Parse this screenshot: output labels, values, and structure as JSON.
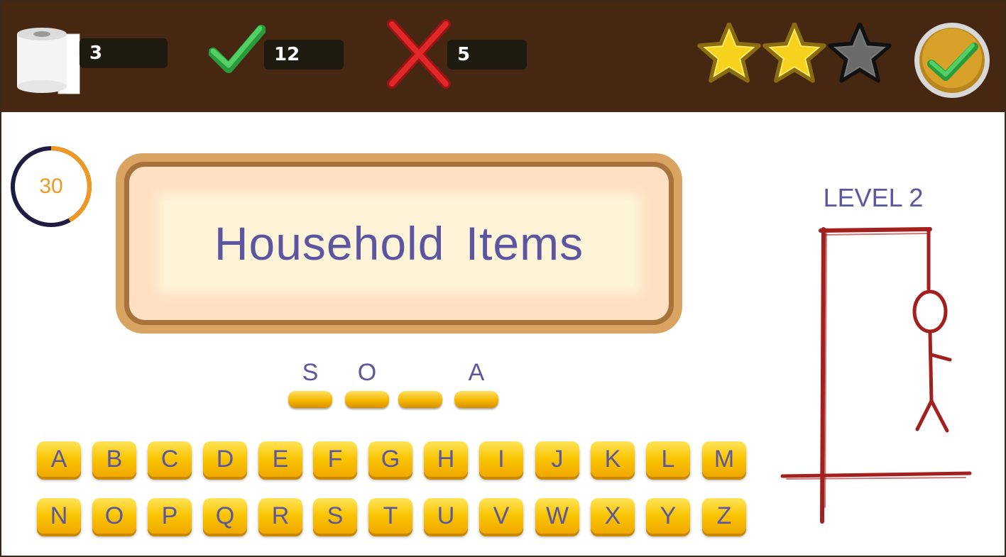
{
  "header": {
    "paper_count": "3",
    "correct_count": "12",
    "wrong_count": "5",
    "stars_earned": 2,
    "stars_total": 3
  },
  "timer": {
    "value": "30",
    "progress": 0.42
  },
  "category": {
    "title": "Household Items"
  },
  "word_slots": [
    "S",
    "O",
    "",
    "A"
  ],
  "keyboard": {
    "row1": [
      "A",
      "B",
      "C",
      "D",
      "E",
      "F",
      "G",
      "H",
      "I",
      "J",
      "K",
      "L",
      "M"
    ],
    "row2": [
      "N",
      "O",
      "P",
      "Q",
      "R",
      "S",
      "T",
      "U",
      "V",
      "W",
      "X",
      "Y",
      "Z"
    ]
  },
  "level": {
    "label": "LEVEL 2"
  },
  "colors": {
    "header_bg": "#462712",
    "accent_text": "#5a56a0",
    "key_yellow": "#f9c400",
    "gallows_red": "#a3201f",
    "timer_orange": "#f09820"
  }
}
